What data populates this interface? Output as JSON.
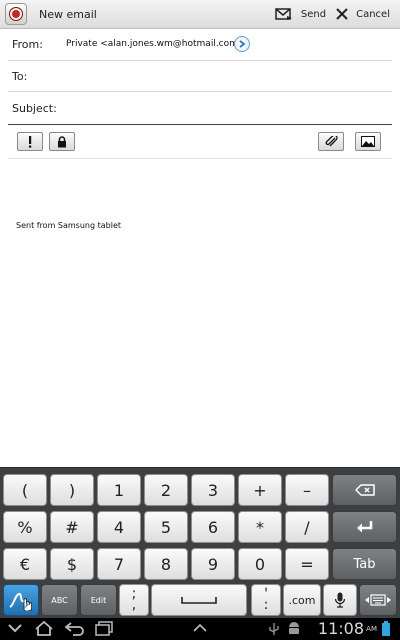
{
  "actionbar": {
    "title": "New email",
    "send_label": "Send",
    "cancel_label": "Cancel",
    "app_icon": "email-app-icon",
    "send_icon": "send-envelope-icon",
    "cancel_icon": "close-x-icon"
  },
  "form": {
    "from_label": "From:",
    "from_value": "Private <alan.jones.wm@hotmail.com>",
    "to_label": "To:",
    "to_value": "",
    "subject_label": "Subject:",
    "subject_value": ""
  },
  "toolbar": {
    "priority_icon": "exclamation-icon",
    "security_icon": "lock-icon",
    "attach_icon": "paperclip-icon",
    "image_icon": "picture-icon"
  },
  "body": {
    "signature": "Sent from Samsung tablet"
  },
  "keyboard": {
    "row1": [
      "(",
      ")",
      "1",
      "2",
      "3",
      "+",
      "–"
    ],
    "row2": [
      "%",
      "#",
      "4",
      "5",
      "6",
      "*",
      "/"
    ],
    "row3": [
      "€",
      "$",
      "7",
      "8",
      "9",
      "0",
      "="
    ],
    "tab_label": "Tab",
    "abc_label": "ABC",
    "edit_label": "Edit",
    "semicolon_label": ";",
    "comma_label": ",",
    "colon_label": ":",
    "apostrophe_label": "'",
    "dotcom_label": ".com"
  },
  "statusbar": {
    "time": "11:08",
    "ampm": "AM"
  },
  "colors": {
    "keyboard_bg": "#3d3f41",
    "accent_blue": "#2a78b8",
    "record_red": "#c2282a"
  }
}
